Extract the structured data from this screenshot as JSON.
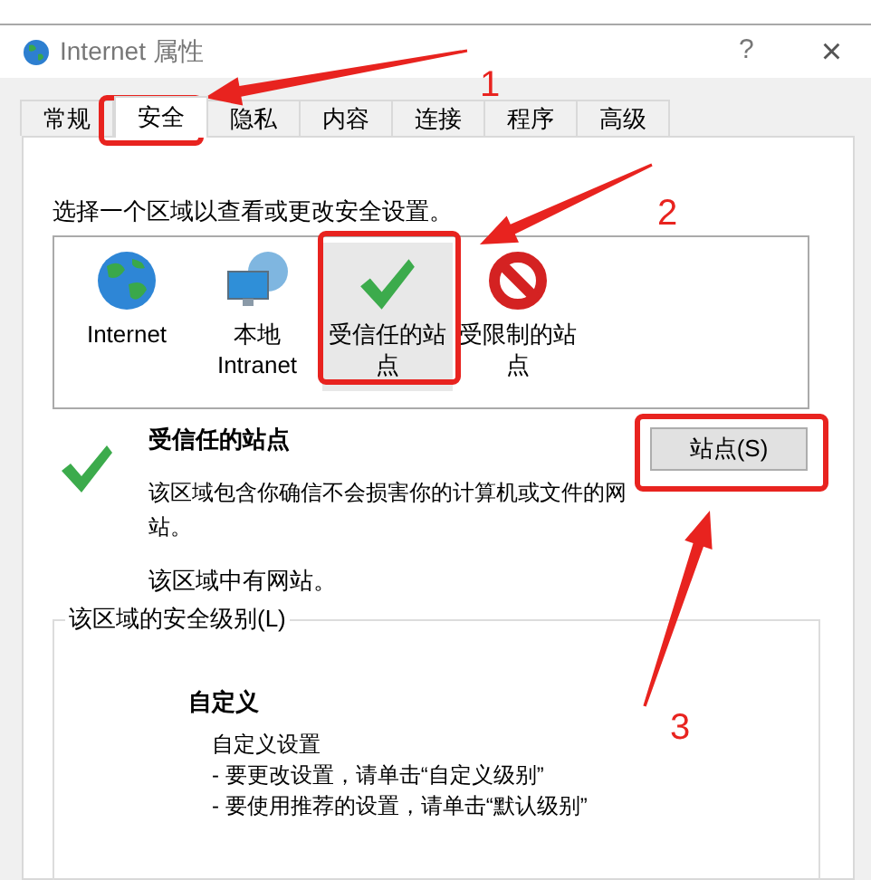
{
  "window": {
    "title": "Internet 属性",
    "help": "?",
    "close": "×"
  },
  "tabs": [
    {
      "label": "常规",
      "selected": false
    },
    {
      "label": "安全",
      "selected": true
    },
    {
      "label": "隐私",
      "selected": false
    },
    {
      "label": "内容",
      "selected": false
    },
    {
      "label": "连接",
      "selected": false
    },
    {
      "label": "程序",
      "selected": false
    },
    {
      "label": "高级",
      "selected": false
    }
  ],
  "instruction": "选择一个区域以查看或更改安全设置。",
  "zones": [
    {
      "label": "Internet",
      "kind": "globe",
      "selected": false
    },
    {
      "label": "本地 Intranet",
      "kind": "intranet",
      "selected": false
    },
    {
      "label": "受信任的站点",
      "kind": "trusted",
      "selected": true
    },
    {
      "label": "受限制的站点",
      "kind": "restricted",
      "selected": false
    }
  ],
  "zone_info": {
    "title": "受信任的站点",
    "description": "该区域包含你确信不会损害你的计算机或文件的网站。",
    "note": "该区域中有网站。",
    "sites_button": "站点(S)"
  },
  "security_level": {
    "legend": "该区域的安全级别(L)",
    "level": "自定义",
    "details": [
      "自定义设置",
      "- 要更改设置，请单击“自定义级别”",
      "- 要使用推荐的设置，请单击“默认级别”"
    ]
  },
  "callouts": [
    {
      "label": "1"
    },
    {
      "label": "2"
    },
    {
      "label": "3"
    }
  ]
}
